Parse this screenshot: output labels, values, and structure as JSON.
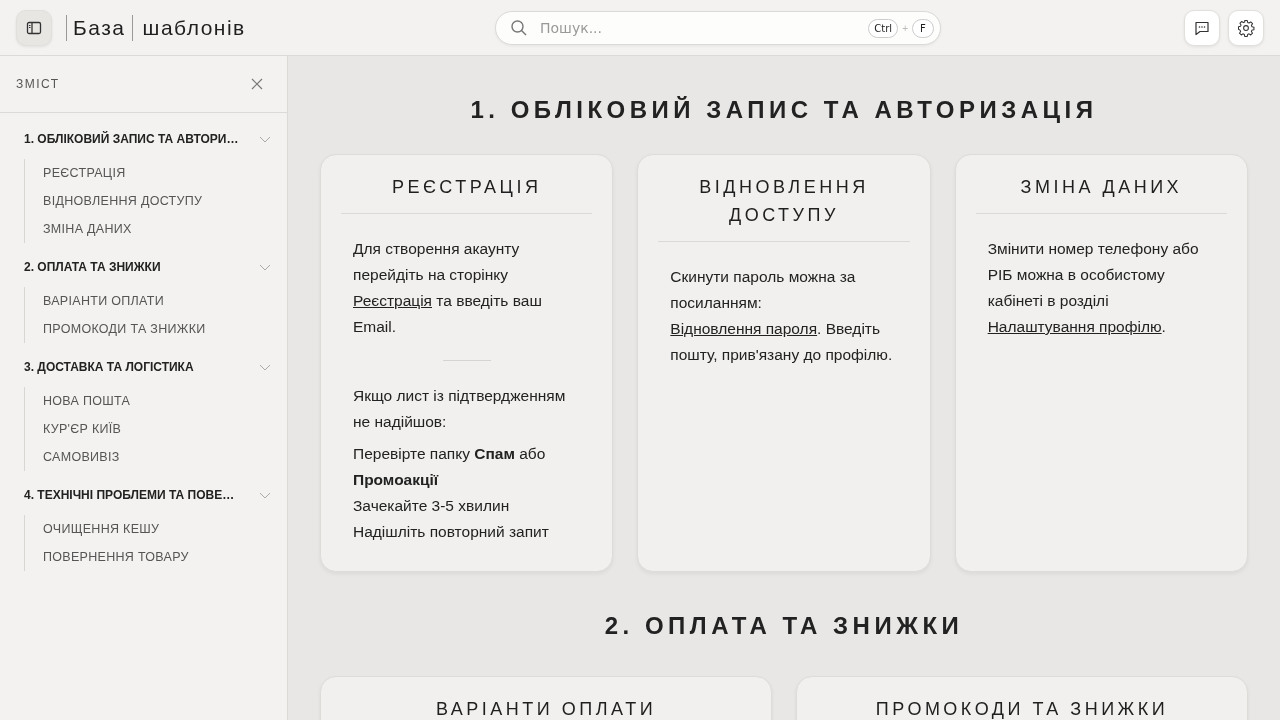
{
  "header": {
    "logo": {
      "boxed": "База",
      "rest": "шаблонів"
    },
    "search": {
      "placeholder": "Пошук...",
      "keys": [
        "Ctrl",
        "F"
      ],
      "separator": "+"
    }
  },
  "sidebar": {
    "title": "ЗМІСТ",
    "groups": [
      {
        "title": "1. ОБЛІКОВИЙ ЗАПИС ТА АВТОРИ…",
        "expanded": true,
        "items": [
          "РЕЄСТРАЦІЯ",
          "ВІДНОВЛЕННЯ ДОСТУПУ",
          "ЗМІНА ДАНИХ"
        ]
      },
      {
        "title": "2. ОПЛАТА ТА ЗНИЖКИ",
        "expanded": true,
        "items": [
          "ВАРІАНТИ ОПЛАТИ",
          "ПРОМОКОДИ ТА ЗНИЖКИ"
        ]
      },
      {
        "title": "3. ДОСТАВКА ТА ЛОГІСТИКА",
        "expanded": true,
        "items": [
          "НОВА ПОШТА",
          "КУР'ЄР КИЇВ",
          "САМОВИВІЗ"
        ]
      },
      {
        "title": "4. ТЕХНІЧНІ ПРОБЛЕМИ ТА ПОВЕ…",
        "expanded": true,
        "items": [
          "ОЧИЩЕННЯ КЕШУ",
          "ПОВЕРНЕННЯ ТОВАРУ"
        ]
      }
    ]
  },
  "sections": [
    {
      "title": "1. ОБЛІКОВИЙ ЗАПИС ТА АВТОРИЗАЦІЯ",
      "cards": [
        {
          "title": "РЕЄСТРАЦІЯ",
          "blocks": [
            {
              "kind": "link-text",
              "before": "Для створення акаунту перейдіть на сторінку ",
              "link": "Реєстрація",
              "after": " та введіть ваш Email."
            },
            {
              "kind": "divider"
            },
            {
              "kind": "text",
              "text": "Якщо лист із підтвердженням не надійшов:"
            },
            {
              "kind": "steps",
              "items": [
                "Перевірте папку **Спам** або **Промоакції**",
                "Зачекайте 3-5 хвилин",
                "Надішліть повторний запит"
              ]
            }
          ]
        },
        {
          "title": "ВІДНОВЛЕННЯ ДОСТУПУ",
          "blocks": [
            {
              "kind": "link-text",
              "before": "Скинути пароль можна за посиланням: ",
              "link": "Відновлення пароля",
              "after": ". Введіть пошту, прив'язану до профілю."
            }
          ]
        },
        {
          "title": "ЗМІНА ДАНИХ",
          "blocks": [
            {
              "kind": "link-text",
              "before": "Змінити номер телефону або РІБ можна в особистому кабінеті в розділі ",
              "link": "Налаштування профілю",
              "after": "."
            }
          ]
        }
      ]
    },
    {
      "title": "2. ОПЛАТА ТА ЗНИЖКИ",
      "cards": [
        {
          "title": "ВАРІАНТИ ОПЛАТИ"
        },
        {
          "title": "ПРОМОКОДИ ТА ЗНИЖКИ"
        }
      ]
    }
  ]
}
